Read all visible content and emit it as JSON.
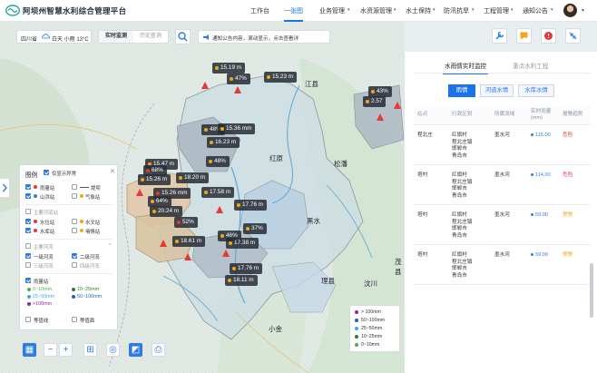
{
  "header": {
    "app_title": "阿坝州智慧水利综合管理平台",
    "nav": [
      {
        "label": "工作台",
        "active": false
      },
      {
        "label": "一张图",
        "active": true
      },
      {
        "label": "业务管理",
        "active": false
      },
      {
        "label": "水资源管理",
        "active": false
      },
      {
        "label": "水土保持",
        "active": false
      },
      {
        "label": "防汛抗旱",
        "active": false
      },
      {
        "label": "工程管理",
        "active": false
      },
      {
        "label": "通知公告",
        "active": false
      }
    ],
    "nav_chevron": "▾",
    "avatar_chevron": "▾"
  },
  "toolbar": {
    "city": "四川省",
    "weather": "白天 小雨 13°C",
    "modes": [
      {
        "label": "实时监测",
        "active": true
      },
      {
        "label": "历史查询",
        "active": false
      }
    ],
    "notice": "通知公告内容，滚动显示，点击查看详"
  },
  "map": {
    "places": [
      {
        "name": "红原"
      },
      {
        "name": "松潘"
      },
      {
        "name": "黑水"
      },
      {
        "name": "理县"
      },
      {
        "name": "汶川"
      },
      {
        "name": "小金"
      },
      {
        "name": "茂县"
      },
      {
        "name": "江县"
      }
    ],
    "stations": [
      {
        "label": "15.19 m",
        "color": "orange"
      },
      {
        "label": "47%",
        "color": "orange"
      },
      {
        "label": "15.23 m",
        "color": "orange"
      },
      {
        "label": "43%",
        "color": "orange"
      },
      {
        "label": "2.57",
        "color": "orange"
      },
      {
        "label": "48%",
        "color": "orange"
      },
      {
        "label": "15.36 mm",
        "color": "orange"
      },
      {
        "label": "16.23 m",
        "color": "orange"
      },
      {
        "label": "48%",
        "color": "orange"
      },
      {
        "label": "15.47 m",
        "color": "orange"
      },
      {
        "label": "68%",
        "color": "red"
      },
      {
        "label": "15.26 m",
        "color": "orange"
      },
      {
        "label": "18.20 m",
        "color": "orange"
      },
      {
        "label": "15.26 mm",
        "color": "red"
      },
      {
        "label": "17.58 m",
        "color": "orange"
      },
      {
        "label": "64%",
        "color": "orange"
      },
      {
        "label": "20.24 m",
        "color": "orange"
      },
      {
        "label": "17.76 m",
        "color": "orange"
      },
      {
        "label": "52%",
        "color": "red"
      },
      {
        "label": "37%",
        "color": "orange"
      },
      {
        "label": "46%",
        "color": "orange"
      },
      {
        "label": "17.38 m",
        "color": "orange"
      },
      {
        "label": "18.61 m",
        "color": "orange"
      },
      {
        "label": "17.76 m",
        "color": "orange"
      },
      {
        "label": "18.11 m",
        "color": "orange"
      }
    ]
  },
  "legend": {
    "title": "图例",
    "only_abnormal": "仅显示异常",
    "close": "✕",
    "groups": [
      {
        "label": "雨量站",
        "checked": true
      },
      {
        "label": "堤坝",
        "checked": false
      },
      {
        "label": "山洪站",
        "checked": true
      },
      {
        "label": "气象站",
        "checked": false
      },
      {
        "label": "主要河道站",
        "checked": false
      },
      {
        "label": "水位站",
        "checked": true
      },
      {
        "label": "水文站",
        "checked": false
      },
      {
        "label": "水库站",
        "checked": true
      },
      {
        "label": "墒情站",
        "checked": false
      },
      {
        "label": "主要河流",
        "checked": false
      },
      {
        "label": "一级河流",
        "checked": true
      },
      {
        "label": "二级河流",
        "checked": true
      },
      {
        "label": "三级河流",
        "checked": false
      },
      {
        "label": "四级河流",
        "checked": false
      },
      {
        "label": "雨量站",
        "checked": true
      }
    ],
    "rain_levels": [
      {
        "label": "0~10mm",
        "color": "#4caf50"
      },
      {
        "label": "10~25mm",
        "color": "#2e7d32"
      },
      {
        "label": "25~50mm",
        "color": "#42a5f5"
      },
      {
        "label": "50~100mm",
        "color": "#1e5bd6"
      },
      {
        "label": ">100mm",
        "color": "#8e24aa"
      }
    ],
    "iso_lines": [
      {
        "label": "等值线"
      },
      {
        "label": "等值面"
      }
    ]
  },
  "rain_legend": [
    {
      "label": "> 100mm",
      "color": "#8e24aa"
    },
    {
      "label": "50~100mm",
      "color": "#1e5bd6"
    },
    {
      "label": "25~50mm",
      "color": "#42a5f5"
    },
    {
      "label": "10~25mm",
      "color": "#2e7d32"
    },
    {
      "label": "0~10mm",
      "color": "#4caf50"
    }
  ],
  "map_tools": [
    {
      "name": "grid-icon",
      "glyph": "▦",
      "highlight": true
    },
    {
      "name": "zoom-out-icon",
      "glyph": "−",
      "highlight": false
    },
    {
      "name": "zoom-in-icon",
      "glyph": "+",
      "highlight": false
    },
    {
      "name": "measure-icon",
      "glyph": "⊞",
      "highlight": false
    },
    {
      "name": "locate-icon",
      "glyph": "◎",
      "highlight": false
    },
    {
      "name": "layer-icon",
      "glyph": "◩",
      "highlight": true
    },
    {
      "name": "export-icon",
      "glyph": "⎙",
      "highlight": false
    }
  ],
  "panel": {
    "tabs": [
      {
        "label": "水雨情实时监控",
        "active": true
      },
      {
        "label": "重点水利工程",
        "active": false
      }
    ],
    "sub_tabs": [
      {
        "label": "雨情",
        "active": true
      },
      {
        "label": "河道水情",
        "active": false
      },
      {
        "label": "水库水情",
        "active": false
      }
    ],
    "columns": [
      "站点",
      "行政区划",
      "所属流域",
      "实时雨量\n(mm)",
      "报警趋势"
    ],
    "rows": [
      {
        "station": "程北庄",
        "region": "红旗村\n程北庄镇\n邯郸市\n青岛市",
        "basin": "墨水河",
        "rain": "115.00",
        "trend": "危险",
        "level": "danger"
      },
      {
        "station": "塔村",
        "region": "红旗村\n程北庄镇\n邯郸市\n青岛市",
        "basin": "墨水河",
        "rain": "114.00",
        "trend": "危险",
        "level": "danger"
      },
      {
        "station": "塔村",
        "region": "红旗村\n程北庄镇\n邯郸市\n青岛市",
        "basin": "墨水河",
        "rain": "59.00",
        "trend": "预警",
        "level": "warn"
      },
      {
        "station": "塔村",
        "region": "红旗村\n程北庄镇\n邯郸市\n青岛市",
        "basin": "墨水河",
        "rain": "59.00",
        "trend": "预警",
        "level": "warn"
      }
    ]
  },
  "colors": {
    "accent": "#1a73e8",
    "danger": "#e53935",
    "warn": "#f0a818",
    "pin_red": "#e53935"
  }
}
